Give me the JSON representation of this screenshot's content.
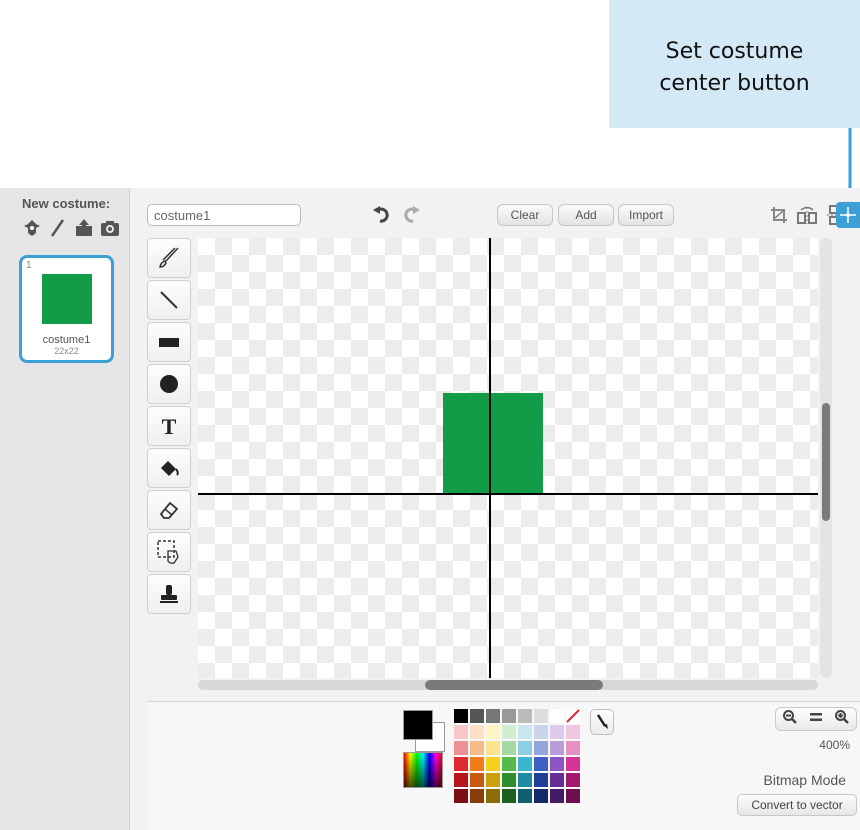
{
  "callout": {
    "text": "Set costume center button"
  },
  "sidebar": {
    "new_costume_label": "New costume:",
    "new_costume_icons": [
      "sprite-library-icon",
      "paint-brush-icon",
      "upload-icon",
      "camera-icon"
    ],
    "costumes": [
      {
        "index": "1",
        "name": "costume1",
        "size": "22x22",
        "color": "#129c48"
      }
    ]
  },
  "toolbar": {
    "costume_name": "costume1",
    "undo_icon": "undo-icon",
    "redo_icon": "redo-icon",
    "clear_label": "Clear",
    "add_label": "Add",
    "import_label": "Import",
    "right_tools": [
      "crop-icon",
      "flip-horizontal-icon",
      "flip-vertical-icon",
      "set-costume-center-icon"
    ]
  },
  "tools": [
    "brush-icon",
    "line-icon",
    "rectangle-icon",
    "ellipse-icon",
    "text-icon",
    "fill-bucket-icon",
    "eraser-icon",
    "select-icon",
    "stamp-icon"
  ],
  "canvas": {
    "costume_color": "#129c48",
    "center_crosshair": true
  },
  "colors": {
    "primary": "#000000",
    "secondary": "#ffffff",
    "palette": [
      "#000000",
      "#555555",
      "#777777",
      "#999999",
      "#bbbbbb",
      "#dddddd",
      "#ffffff",
      "transparent",
      "#f6c6c9",
      "#fbe0c4",
      "#fdf3c4",
      "#d4ecd0",
      "#c9e6ef",
      "#c8d3ec",
      "#dccbeb",
      "#f1c6e0",
      "#ee8f93",
      "#f7b98a",
      "#fbe48d",
      "#a8d8a2",
      "#8ccfe1",
      "#91a7dc",
      "#b89bd8",
      "#e58fc3",
      "#e02a31",
      "#f07d1a",
      "#f7d21c",
      "#58b84e",
      "#3cb6cf",
      "#3c61c3",
      "#8c56c2",
      "#d63598",
      "#b5161d",
      "#c85a0e",
      "#c9a20d",
      "#2f8f2e",
      "#1d8ca3",
      "#203f96",
      "#642e94",
      "#a3196f",
      "#7b0e12",
      "#8a3d09",
      "#8a6c08",
      "#1d6020",
      "#125e6e",
      "#132a66",
      "#421d64",
      "#6c0f4a"
    ]
  },
  "zoom": {
    "zoom_out_icon": "zoom-out-icon",
    "reset_icon": "zoom-reset-icon",
    "zoom_in_icon": "zoom-in-icon",
    "level": "400%"
  },
  "mode": {
    "label": "Bitmap Mode",
    "convert_label": "Convert to vector"
  }
}
